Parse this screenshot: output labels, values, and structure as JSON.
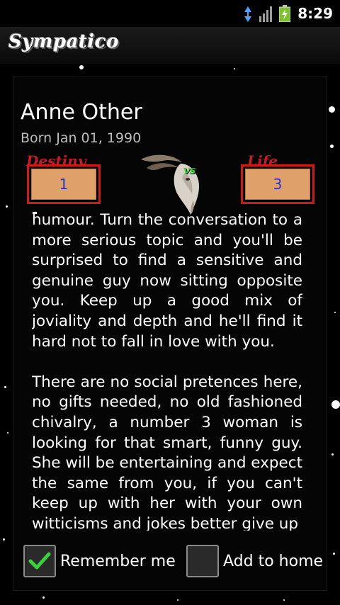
{
  "status_bar": {
    "time": "8:29",
    "icons": [
      "network-transfer-icon",
      "signal-icon",
      "battery-charging-icon"
    ]
  },
  "app": {
    "title": "Sympatico"
  },
  "profile": {
    "name": "Anne Other",
    "born": "Born Jan 01, 1990"
  },
  "numbers": {
    "destiny_label": "Destiny",
    "destiny_value": "1",
    "life_label": "Life",
    "life_value": "3",
    "vs_label": "vs",
    "center_icon": "capricorn-goat-icon"
  },
  "reading": {
    "paragraphs": [
      "humour. Turn the conversation to a more serious topic and you'll be surprised to find a sensitive and genuine guy now sitting opposite you. Keep up a good mix of joviality and depth and he'll find it hard not to fall in love with you.",
      "There are no social pretences here, no gifts needed, no old fashioned chivalry, a number 3 woman is looking for that smart, funny guy. She will be entertaining and expect the same from you, if you can't keep up with her with your own witticisms and jokes better give up"
    ]
  },
  "options": {
    "remember_me": {
      "label": "Remember me",
      "checked": true
    },
    "add_to_home": {
      "label": "Add to home",
      "checked": false
    }
  },
  "colors": {
    "accent_red": "#d01a1a",
    "box_fill": "#e0a06a",
    "number_text": "#2434d6",
    "check_green": "#3bd13b"
  }
}
